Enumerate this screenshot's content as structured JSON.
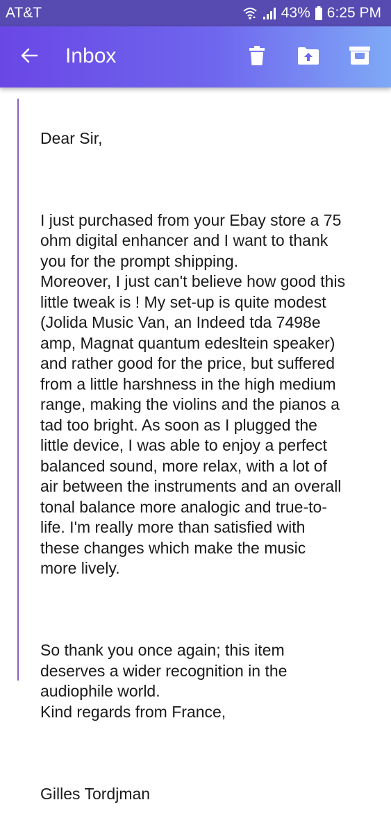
{
  "status_bar": {
    "carrier": "AT&T",
    "battery": "43%",
    "time": "6:25 PM",
    "icons": [
      "wifi-icon",
      "signal-icon",
      "battery-icon"
    ]
  },
  "app_bar": {
    "title": "Inbox",
    "icons": [
      "back-arrow-icon",
      "delete-icon",
      "move-to-folder-icon",
      "archive-icon"
    ],
    "colors": {
      "gradient_start": "#6a47e5",
      "gradient_end": "#7fa9f6"
    }
  },
  "email": {
    "greeting": "Dear Sir,",
    "paragraph_1": "I just purchased from your Ebay store a 75\nohm digital enhancer and I want to thank\nyou for the prompt shipping.\nMoreover, I just can't believe how good this\nlittle tweak is ! My set-up is quite modest\n(Jolida Music Van, an Indeed tda 7498e\namp, Magnat quantum edesltein speaker)\nand rather good for the price, but suffered\nfrom a little harshness in the high medium\nrange, making the violins and the pianos a\ntad too bright. As soon as I plugged the\nlittle device, I was able to enjoy a perfect\nbalanced sound, more relax, with a lot of\nair between the instruments and an overall\ntonal balance more analogic and true-to-\nlife. I'm really more than satisfied with\nthese changes which make the music\nmore lively.",
    "paragraph_2": "So thank you once again; this item\ndeserves a wider recognition in the\naudiophile world.\nKind regards from France,",
    "signature": "Gilles Tordjman",
    "quote_bar_color": "#8c5fbf"
  }
}
